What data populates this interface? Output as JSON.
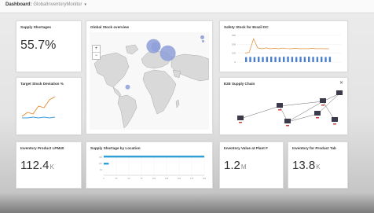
{
  "header": {
    "title": "Dashboard:",
    "subtitle": "GlobalInventoryMonitor",
    "chevron": "▾"
  },
  "tiles": {
    "supply_shortages": {
      "title": "Supply Shortages",
      "value": "55.7%"
    },
    "global_stock": {
      "title": "Global Stock overview",
      "zoom_in": "+",
      "zoom_out": "−"
    },
    "safety_stock": {
      "title": "Safety Stock for Brazil DC"
    },
    "target_deviation": {
      "title": "Target Stock Deviation %"
    },
    "e2e_chain": {
      "title": "E2E Supply Chain",
      "close": "✕"
    },
    "inventory_lpm": {
      "title": "Inventory Product LPM40",
      "value": "112.4",
      "unit": "K"
    },
    "shortage_location": {
      "title": "Supply Shortage by Location"
    },
    "inventory_value": {
      "title": "Inventory Value at Plant F",
      "value": "1.2",
      "unit": "M"
    },
    "inventory_product": {
      "title": "Inventory for Product Tab",
      "value": "13.8",
      "unit": "K"
    }
  },
  "chart_data": [
    {
      "type": "scatter",
      "title": "Global Stock overview",
      "points": [
        {
          "lon": -52,
          "lat": -12,
          "size": 3
        },
        {
          "lon": 13,
          "lat": 51,
          "size": 9
        },
        {
          "lon": 19,
          "lat": 50,
          "size": 6
        },
        {
          "lon": 49,
          "lat": 40,
          "size": 10
        }
      ]
    },
    {
      "type": "bar",
      "title": "Safety Stock for Brazil DC",
      "values": [
        55,
        58,
        56,
        60,
        57,
        59,
        61,
        58,
        56,
        60,
        62,
        59,
        57,
        60,
        58,
        61,
        59,
        58,
        60,
        57,
        59
      ],
      "line": [
        100,
        112,
        260,
        160,
        150,
        160,
        150,
        155,
        150,
        158,
        152,
        150,
        155,
        150,
        152,
        150,
        155,
        150,
        152,
        150,
        150
      ],
      "ylim": [
        0,
        300
      ]
    },
    {
      "type": "line",
      "title": "Target Stock Deviation %",
      "series": [
        {
          "values": [
            5,
            10,
            8,
            18,
            16,
            26,
            30
          ]
        },
        {
          "values": [
            3,
            3,
            4,
            3,
            4,
            3,
            4
          ]
        }
      ]
    },
    {
      "type": "bar",
      "title": "Supply Shortage by Location",
      "categories": [
        "A",
        "B"
      ],
      "values": [
        200,
        10
      ],
      "xlim": [
        0,
        200
      ]
    }
  ]
}
